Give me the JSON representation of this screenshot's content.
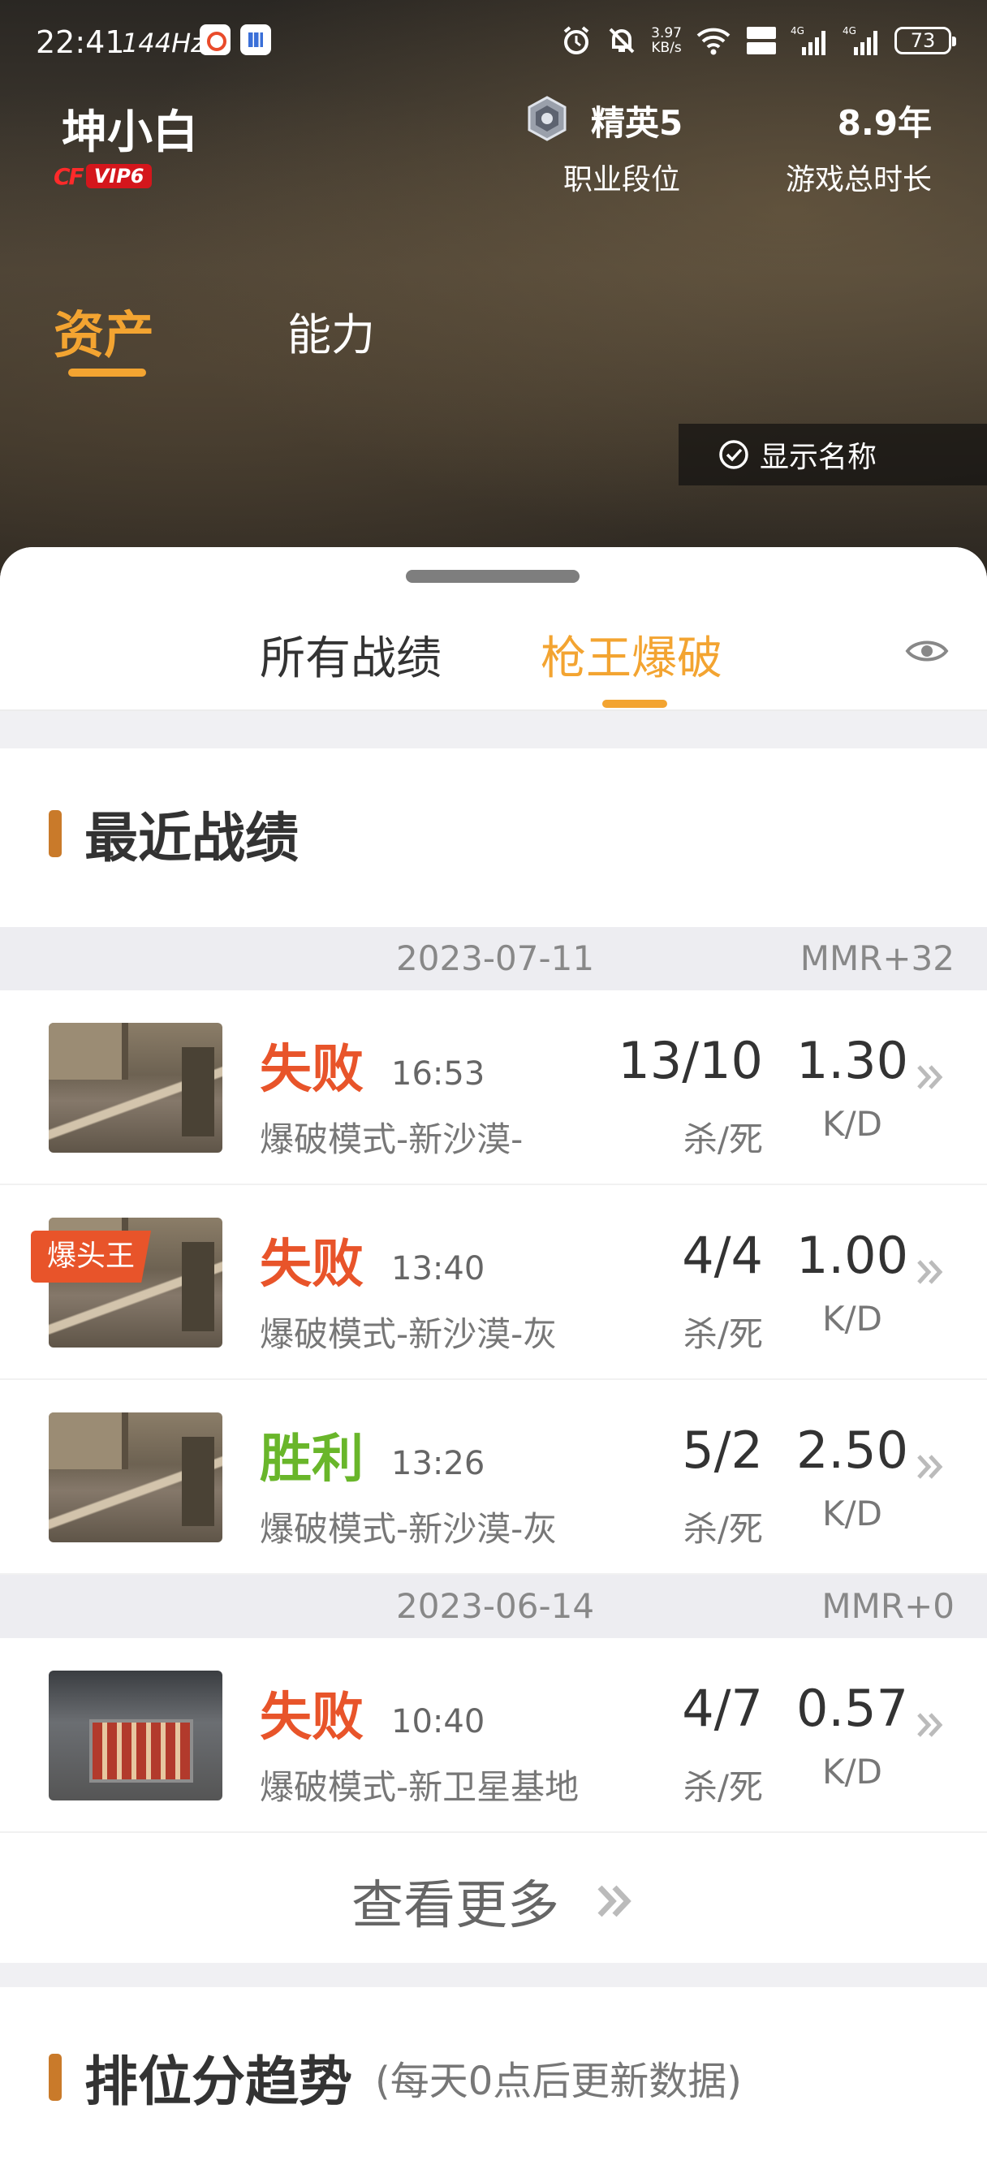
{
  "status_bar": {
    "time": "22:41",
    "refresh_rate": "144Hz",
    "net_speed_value": "3.97",
    "net_speed_unit": "KB/s",
    "battery": "73"
  },
  "profile": {
    "name": "坤小白",
    "vip": "VIP6",
    "rank_value": "精英5",
    "rank_label": "职业段位",
    "play_time_value": "8.9年",
    "play_time_label": "游戏总时长"
  },
  "top_tabs": [
    {
      "label": "资产",
      "active": true
    },
    {
      "label": "能力",
      "active": false
    }
  ],
  "show_name_button": "显示名称",
  "record_tabs": [
    {
      "label": "所有战绩",
      "active": false
    },
    {
      "label": "枪王爆破",
      "active": true
    }
  ],
  "recent_section": {
    "title": "最近战绩",
    "groups": [
      {
        "date": "2023-07-11",
        "mmr": "MMR+32",
        "matches": [
          {
            "result": "失败",
            "outcome": "lose",
            "time": "16:53",
            "mode": "爆破模式-新沙漠-",
            "kills_deaths": "13/10",
            "kd_label": "杀/死",
            "kd_ratio": "1.30",
            "kd_ratio_label": "K/D",
            "badge": "",
            "map": "sand"
          },
          {
            "result": "失败",
            "outcome": "lose",
            "time": "13:40",
            "mode": "爆破模式-新沙漠-灰",
            "kills_deaths": "4/4",
            "kd_label": "杀/死",
            "kd_ratio": "1.00",
            "kd_ratio_label": "K/D",
            "badge": "爆头王",
            "map": "sand"
          },
          {
            "result": "胜利",
            "outcome": "win",
            "time": "13:26",
            "mode": "爆破模式-新沙漠-灰",
            "kills_deaths": "5/2",
            "kd_label": "杀/死",
            "kd_ratio": "2.50",
            "kd_ratio_label": "K/D",
            "badge": "",
            "map": "sand"
          }
        ]
      },
      {
        "date": "2023-06-14",
        "mmr": "MMR+0",
        "matches": [
          {
            "result": "失败",
            "outcome": "lose",
            "time": "10:40",
            "mode": "爆破模式-新卫星基地",
            "kills_deaths": "4/7",
            "kd_label": "杀/死",
            "kd_ratio": "0.57",
            "kd_ratio_label": "K/D",
            "badge": "",
            "map": "base"
          }
        ]
      }
    ],
    "view_more": "查看更多"
  },
  "trend_section": {
    "title": "排位分趋势",
    "note": "(每天0点后更新数据)"
  },
  "colors": {
    "accent": "#f3a431",
    "lose": "#e8542a",
    "win": "#69b62a",
    "section_bar": "#c97a2a"
  }
}
